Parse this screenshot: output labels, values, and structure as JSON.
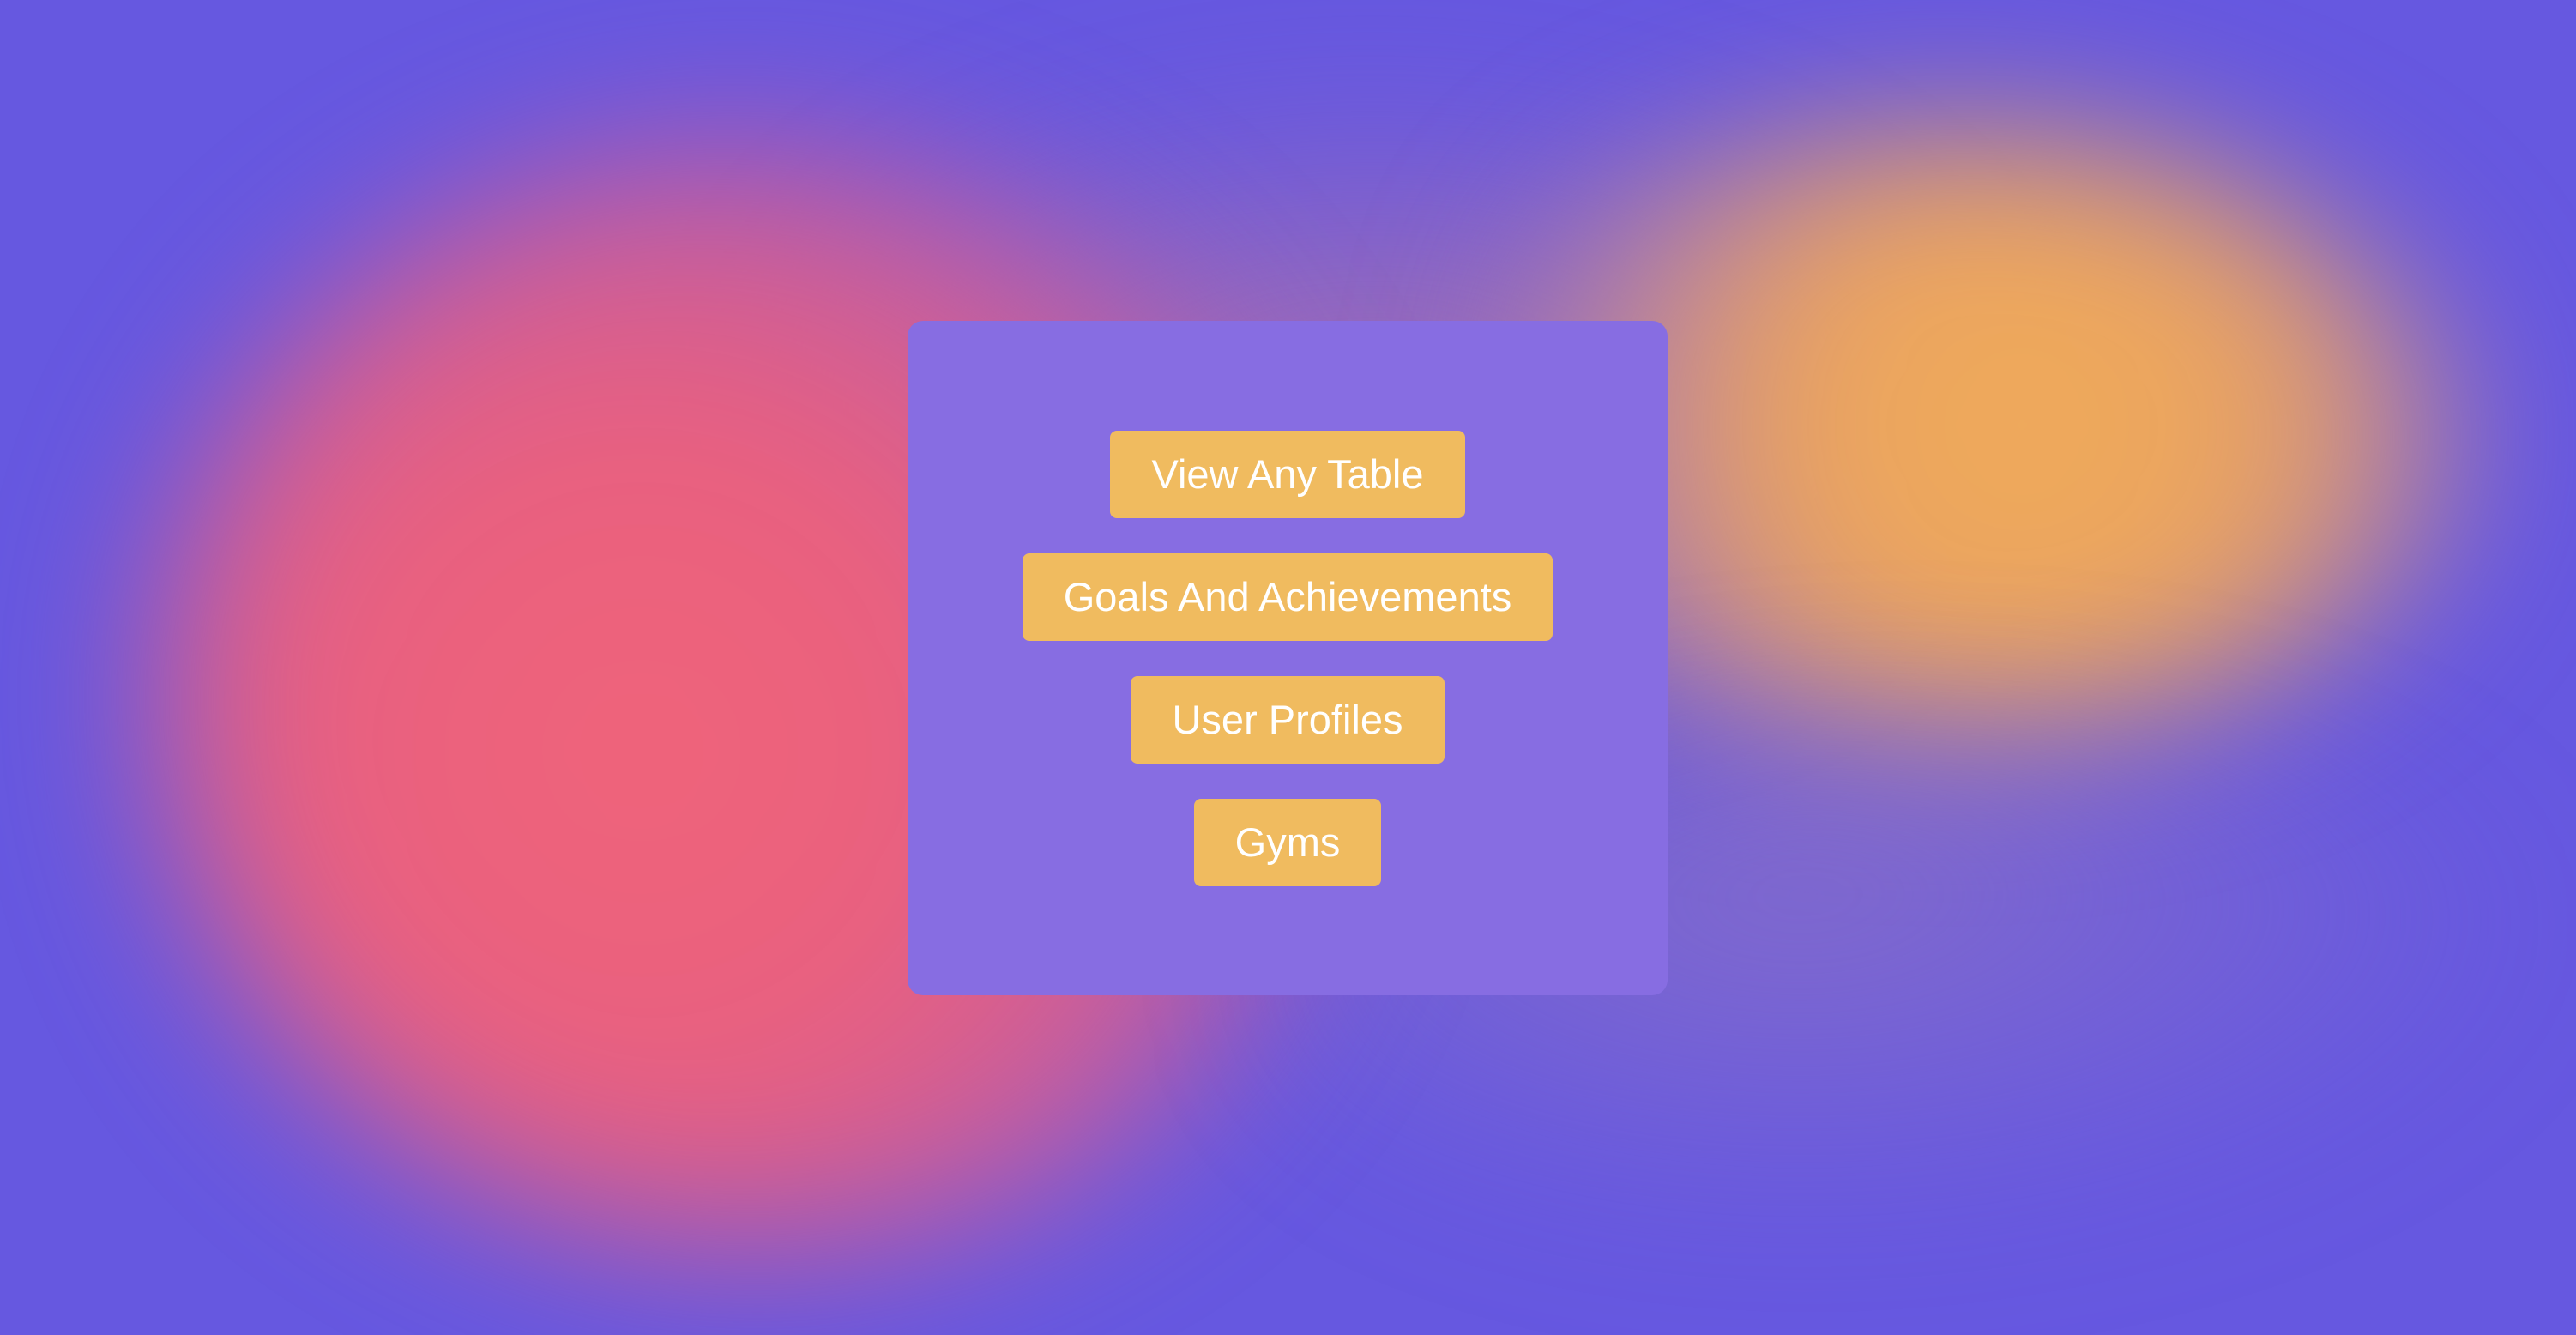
{
  "menu": {
    "buttons": [
      {
        "label": "View Any Table"
      },
      {
        "label": "Goals And Achievements"
      },
      {
        "label": "User Profiles"
      },
      {
        "label": "Gyms"
      }
    ]
  },
  "colors": {
    "panel_bg": "#876de2",
    "button_bg": "#f0bb5f",
    "button_text": "#ffffff",
    "background_base": "#6658e0",
    "background_pink": "#f0647a",
    "background_orange": "#f0ac5a"
  }
}
